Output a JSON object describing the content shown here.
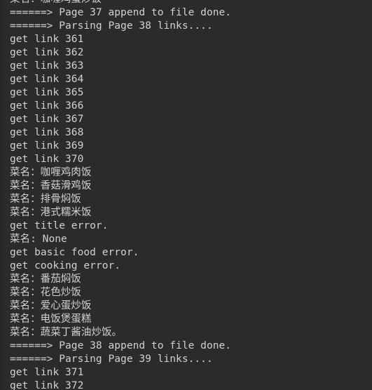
{
  "window": {
    "kind": "terminal-console-output",
    "background_color": "#2b2b2b",
    "text_color": "#d2d2d2",
    "gutter_color": "#282828"
  },
  "console": {
    "lines": [
      "菜名：咖喱鸡蛋炒饭",
      "======> Page 37 append to file done.",
      "======> Parsing Page 38 links....",
      "get link 361",
      "get link 362",
      "get link 363",
      "get link 364",
      "get link 365",
      "get link 366",
      "get link 367",
      "get link 368",
      "get link 369",
      "get link 370",
      "菜名：咖喱鸡肉饭",
      "菜名：香菇滑鸡饭",
      "菜名：排骨焖饭",
      "菜名：港式糯米饭",
      "get title error.",
      "菜名: None",
      "get basic food error.",
      "get cooking error.",
      "菜名：番茄焖饭",
      "菜名：花色炒饭",
      "菜名：爱心蛋炒饭",
      "菜名：电饭煲蛋糕",
      "菜名：蔬菜丁酱油炒饭。",
      "======> Page 38 append to file done.",
      "======> Parsing Page 39 links....",
      "get link 371",
      "get link 372"
    ]
  }
}
